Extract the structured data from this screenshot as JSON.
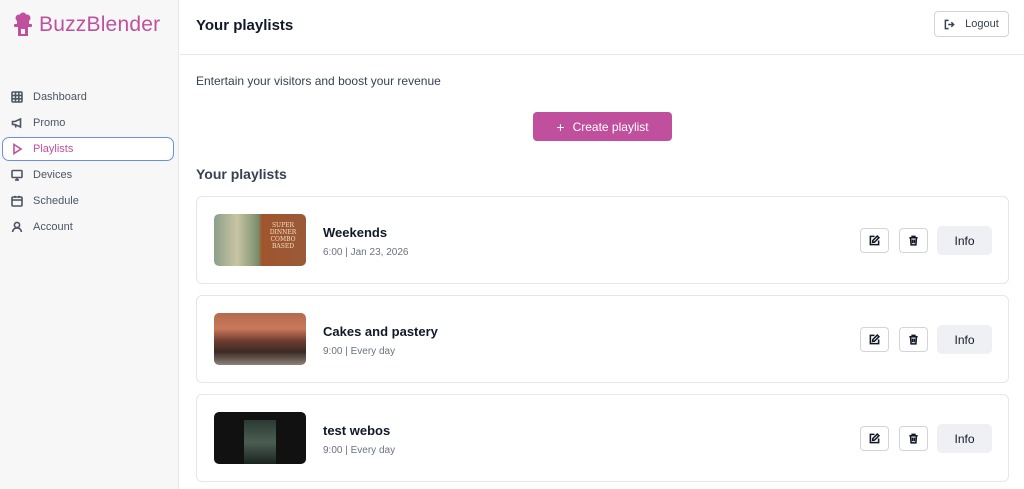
{
  "brand": {
    "name": "BuzzBlender",
    "color": "#c0509d"
  },
  "sidebar": {
    "items": [
      {
        "label": "Dashboard",
        "icon": "grid-icon",
        "active": false
      },
      {
        "label": "Promo",
        "icon": "megaphone-icon",
        "active": false
      },
      {
        "label": "Playlists",
        "icon": "play-icon",
        "active": true
      },
      {
        "label": "Devices",
        "icon": "monitor-icon",
        "active": false
      },
      {
        "label": "Schedule",
        "icon": "calendar-icon",
        "active": false
      },
      {
        "label": "Account",
        "icon": "user-icon",
        "active": false
      }
    ]
  },
  "header": {
    "title": "Your playlists",
    "logout_label": "Logout"
  },
  "main": {
    "subtitle": "Entertain your visitors and boost your revenue",
    "create_label": "Create playlist",
    "section_title": "Your playlists",
    "playlists": [
      {
        "title": "Weekends",
        "meta": "6:00 | Jan 23, 2026",
        "info_label": "Info",
        "thumb_text": "SUPER DINNER COMBO BASED"
      },
      {
        "title": "Cakes and pastery",
        "meta": "9:00 | Every day",
        "info_label": "Info"
      },
      {
        "title": "test webos",
        "meta": "9:00 | Every day",
        "info_label": "Info"
      }
    ]
  }
}
